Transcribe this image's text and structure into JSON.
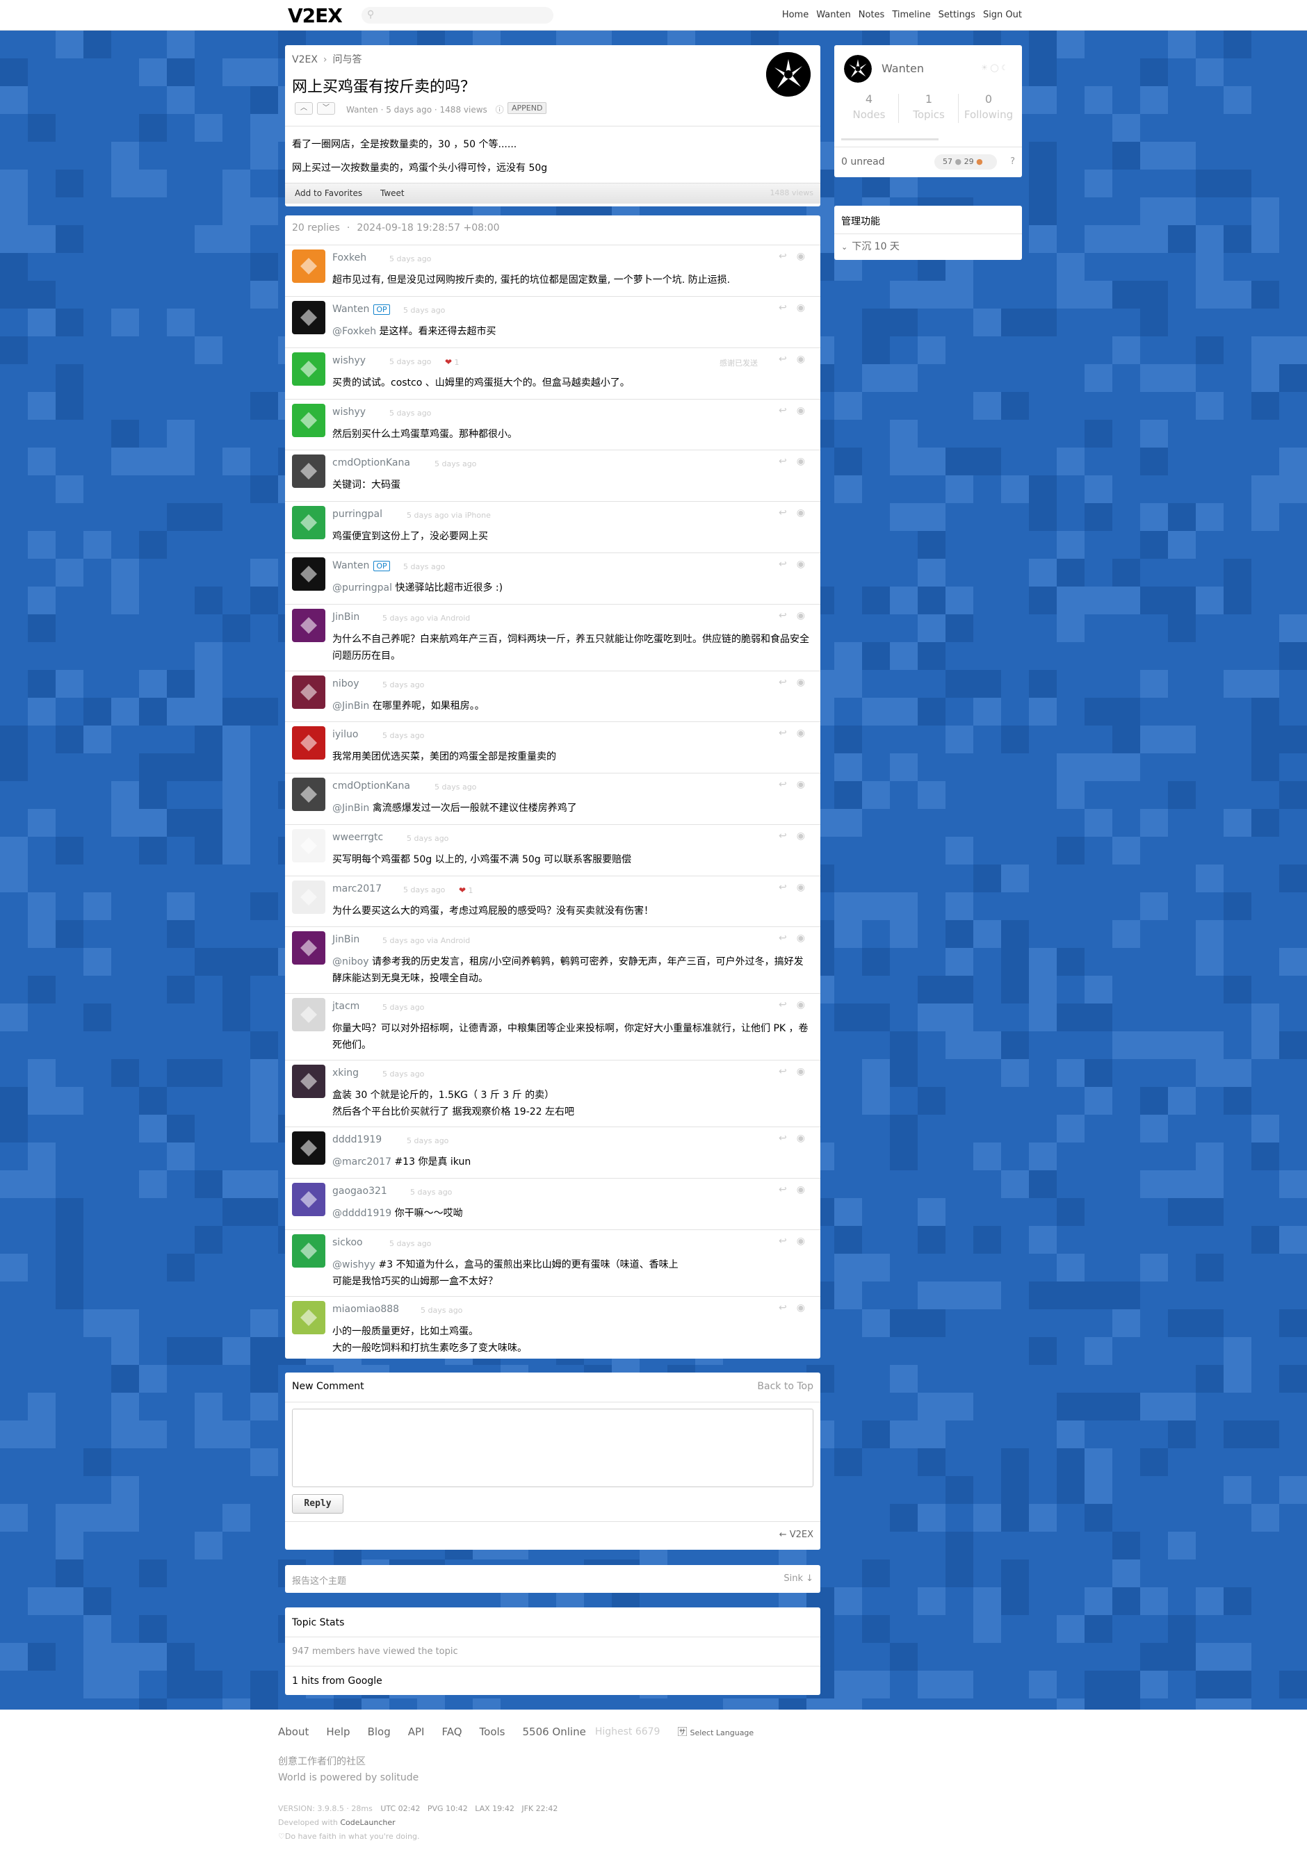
{
  "topbar": {
    "logo": "V2EX",
    "nav": [
      "Home",
      "Wanten",
      "Notes",
      "Timeline",
      "Settings",
      "Sign Out"
    ]
  },
  "topic": {
    "breadcrumb_root": "V2EX",
    "breadcrumb_node": "问与答",
    "title": "网上买鸡蛋有按斤卖的吗？",
    "meta": "Wanten · 5 days ago · 1488 views",
    "append_label": "APPEND",
    "content_p1": "看了一圈网店，全是按数量卖的，30 ，50 个等......",
    "content_p2": "网上买过一次按数量卖的，鸡蛋个头小得可怜，远没有 50g",
    "add_favorites": "Add to Favorites",
    "tweet": "Tweet",
    "views_right": "1488 views"
  },
  "replies_header": {
    "count": "20 replies",
    "time": "2024-09-18 19:28:57 +08:00"
  },
  "replies": [
    {
      "user": "Foxkeh",
      "ago": "5 days ago",
      "op": false,
      "thanks": "",
      "text": "超市见过有, 但是没见过网购按斤卖的, 蛋托的坑位都是固定数量, 一个萝卜一个坑. 防止运损.",
      "color": "#f08a24"
    },
    {
      "user": "Wanten",
      "ago": "5 days ago",
      "op": true,
      "thanks": "",
      "at": "@Foxkeh",
      "text": " 是这样。看来还得去超市买",
      "color": "#111"
    },
    {
      "user": "wishyy",
      "ago": "5 days ago",
      "op": false,
      "thanks": "1",
      "note": "感谢已发送",
      "text": "买贵的试试。costco 、山姆里的鸡蛋挺大个的。但盒马越卖越小了。",
      "color": "#2db53a"
    },
    {
      "user": "wishyy",
      "ago": "5 days ago",
      "op": false,
      "thanks": "",
      "text": "然后别买什么土鸡蛋草鸡蛋。那种都很小。",
      "color": "#2db53a"
    },
    {
      "user": "cmdOptionKana",
      "ago": "5 days ago",
      "op": false,
      "thanks": "",
      "text": "关键词：大码蛋",
      "color": "#444"
    },
    {
      "user": "purringpal",
      "ago": "5 days ago via iPhone",
      "op": false,
      "thanks": "",
      "text": "鸡蛋便宜到这份上了，没必要网上买",
      "color": "#2aa84a"
    },
    {
      "user": "Wanten",
      "ago": "5 days ago",
      "op": true,
      "thanks": "",
      "at": "@purringpal",
      "text": " 快递驿站比超市近很多 :)",
      "color": "#111"
    },
    {
      "user": "JinBin",
      "ago": "5 days ago via Android",
      "op": false,
      "thanks": "",
      "text": "为什么不自己养呢？白来航鸡年产三百，饲料两块一斤，养五只就能让你吃蛋吃到吐。供应链的脆弱和食品安全问题历历在目。",
      "color": "#6a1b6a"
    },
    {
      "user": "niboy",
      "ago": "5 days ago",
      "op": false,
      "thanks": "",
      "at": "@JinBin",
      "text": " 在哪里养呢，如果租房。。",
      "color": "#7a1f3a"
    },
    {
      "user": "iyiluo",
      "ago": "5 days ago",
      "op": false,
      "thanks": "",
      "text": "我常用美团优选买菜，美团的鸡蛋全部是按重量卖的",
      "color": "#c21b1b"
    },
    {
      "user": "cmdOptionKana",
      "ago": "5 days ago",
      "op": false,
      "thanks": "",
      "at": "@JinBin",
      "text": " 禽流感爆发过一次后一般就不建议住楼房养鸡了",
      "color": "#444"
    },
    {
      "user": "wweerrgtc",
      "ago": "5 days ago",
      "op": false,
      "thanks": "",
      "text": "买写明每个鸡蛋都 50g 以上的, 小鸡蛋不满 50g 可以联系客服要赔偿",
      "color": "#f5f5f5"
    },
    {
      "user": "marc2017",
      "ago": "5 days ago",
      "op": false,
      "thanks": "1",
      "text": "为什么要买这么大的鸡蛋，考虑过鸡屁股的感受吗？没有买卖就没有伤害！",
      "color": "#eee"
    },
    {
      "user": "JinBin",
      "ago": "5 days ago via Android",
      "op": false,
      "thanks": "",
      "at": "@niboy",
      "text": " 请参考我的历史发言，租房/小空间养鹌鹑，鹌鹑可密养，安静无声，年产三百，可户外过冬，搞好发酵床能达到无臭无味，投喂全自动。",
      "color": "#6a1b6a"
    },
    {
      "user": "jtacm",
      "ago": "5 days ago",
      "op": false,
      "thanks": "",
      "text": "你量大吗？可以对外招标啊，让德青源，中粮集团等企业来投标啊，你定好大小重量标准就行，让他们 PK ，卷死他们。",
      "color": "#d8d8d8"
    },
    {
      "user": "xking",
      "ago": "5 days ago",
      "op": false,
      "thanks": "",
      "text": "盒装 30 个就是论斤的，1.5KG（ 3 斤 3 斤 的卖）\n然后各个平台比价买就行了 据我观察价格 19-22 左右吧",
      "color": "#3a2a3a"
    },
    {
      "user": "dddd1919",
      "ago": "5 days ago",
      "op": false,
      "thanks": "",
      "at": "@marc2017",
      "text": " #13 你是真 ikun",
      "color": "#111"
    },
    {
      "user": "gaogao321",
      "ago": "5 days ago",
      "op": false,
      "thanks": "",
      "at": "@dddd1919",
      "text": " 你干嘛～～哎呦",
      "color": "#5a4aa8"
    },
    {
      "user": "sickoo",
      "ago": "5 days ago",
      "op": false,
      "thanks": "",
      "at": "@wishyy",
      "text": " #3 不知道为什么，盒马的蛋煎出来比山姆的更有蛋味（味道、香味上\n可能是我恰巧买的山姆那一盒不太好？",
      "color": "#2aa84a"
    },
    {
      "user": "miaomiao888",
      "ago": "5 days ago",
      "op": false,
      "thanks": "",
      "text": "小的一般质量更好，比如土鸡蛋。\n大的一般吃饲料和打抗生素吃多了变大味味。",
      "color": "#9ac44a"
    }
  ],
  "new_comment": {
    "title": "New Comment",
    "back_to_top": "Back to Top",
    "reply_button": "Reply",
    "footer_link": "← V2EX"
  },
  "report": {
    "label": "报告这个主题",
    "sink": "Sink ↓"
  },
  "topic_stats": {
    "title": "Topic Stats",
    "viewed": "947 members have viewed the topic",
    "google": "1 hits from Google"
  },
  "sidebar": {
    "username": "Wanten",
    "stats": [
      {
        "value": "4",
        "label": "Nodes"
      },
      {
        "value": "1",
        "label": "Topics"
      },
      {
        "value": "0",
        "label": "Following"
      }
    ],
    "unread": "0 unread",
    "coins": "57",
    "coins2": "29",
    "admin_title": "管理功能",
    "admin_item": "下沉 10 天"
  },
  "footer": {
    "links": [
      "About",
      "Help",
      "Blog",
      "API",
      "FAQ",
      "Tools"
    ],
    "online": "5506 Online",
    "highest": "Highest 6679",
    "language": "Select Language",
    "slogan1": "创意工作者们的社区",
    "slogan2": "World is powered by solitude",
    "version": "VERSION: 3.9.8.5 · 28ms",
    "times": "UTC 02:42   PVG 10:42   LAX 19:42   JFK 22:42",
    "dev": "Developed with",
    "dev_link": "CodeLauncher",
    "faith": "♡Do have faith in what you're doing."
  }
}
